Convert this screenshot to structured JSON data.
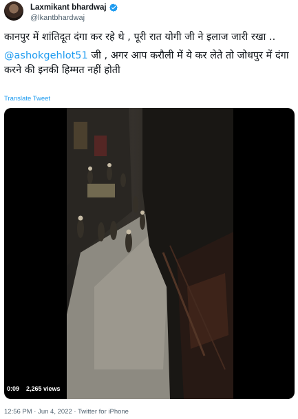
{
  "author": {
    "name": "Laxmikant bhardwaj",
    "handle": "@lkantbhardwaj",
    "verified_icon": "verified-badge-icon",
    "badge_color": "#1d9bf0"
  },
  "tweet": {
    "line1": "कानपुर में शांतिदूत दंगा कर रहे थे , पूरी रात योगी जी ने इलाज जारी रखा ..",
    "mention": "@ashokgehlot51",
    "line2_rest": " जी , अगर आप करौली में ये कर लेते तो जोधपुर में दंगा करने की इनकी हिम्मत नहीं होती",
    "translate_label": "Translate Tweet"
  },
  "video": {
    "duration": "0:09",
    "views": "2,265 views"
  },
  "footer": {
    "meta": "12:56 PM · Jun 4, 2022 · Twitter for iPhone"
  }
}
